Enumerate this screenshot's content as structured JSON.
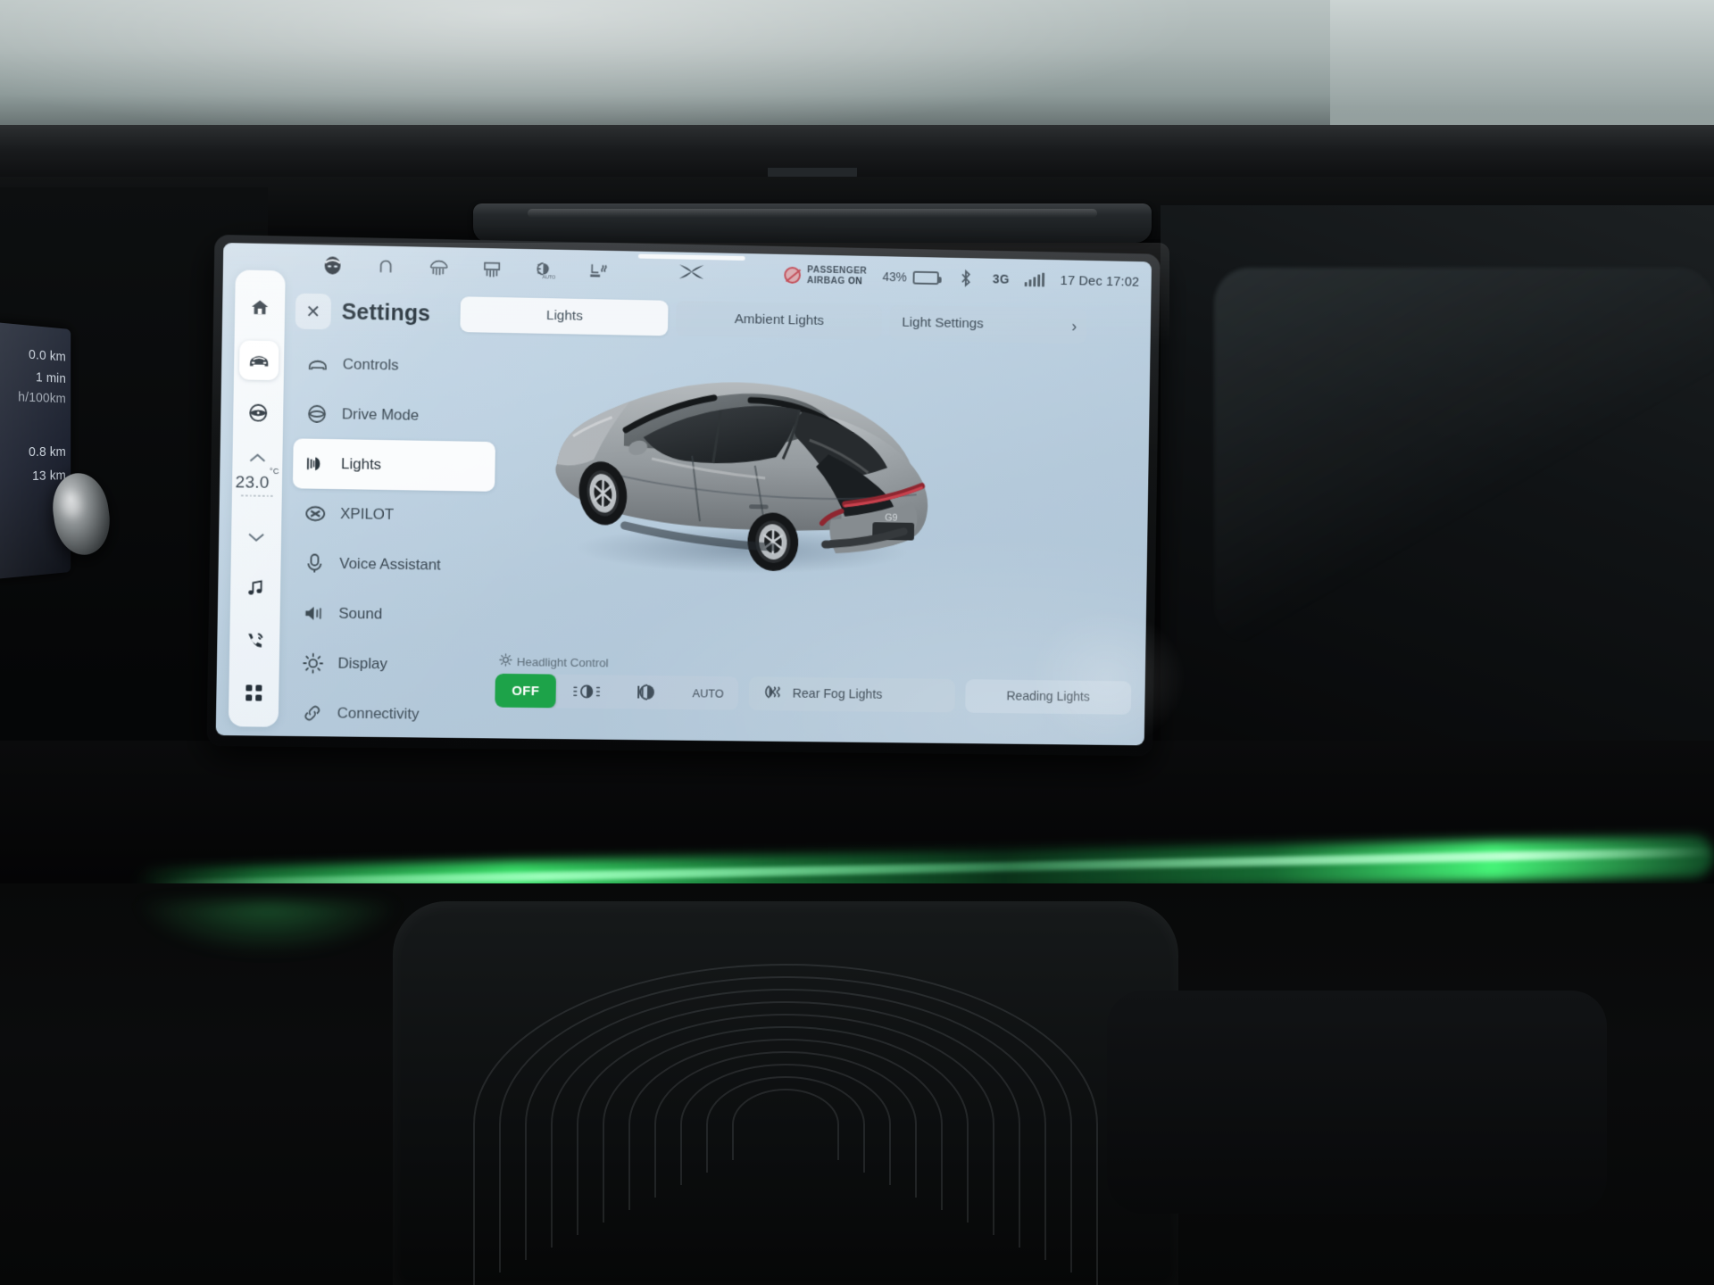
{
  "cluster": {
    "rows": [
      "0.0 km",
      "1 min",
      "h/100km",
      "0.8 km",
      "13 km"
    ]
  },
  "statusbar": {
    "icons": [
      "profile-avatar-icon",
      "headrest-icon",
      "rear-defrost-icon",
      "front-defrost-icon",
      "auto-headlight-icon",
      "seat-heating-icon"
    ],
    "brand_logo": "xpeng-x-logo",
    "airbag_line1": "PASSENGER",
    "airbag_line2_prefix": "AIRBAG",
    "airbag_state": "ON",
    "battery_percent": "43%",
    "bluetooth": "bluetooth-icon",
    "network": "3G",
    "clock": "17 Dec 17:02"
  },
  "rail": {
    "items": [
      {
        "name": "home-icon",
        "label": "Home"
      },
      {
        "name": "car-icon",
        "label": "Vehicle"
      },
      {
        "name": "steering-wheel-icon",
        "label": "Driving"
      }
    ],
    "temp_up": "chevron-up-icon",
    "temperature": "23.0",
    "temperature_unit": "°C",
    "temp_down": "chevron-down-icon",
    "bottom_items": [
      {
        "name": "music-note-icon",
        "label": "Media"
      },
      {
        "name": "phone-icon",
        "label": "Phone"
      },
      {
        "name": "apps-grid-icon",
        "label": "Apps"
      }
    ]
  },
  "page": {
    "close_label": "✕",
    "title": "Settings"
  },
  "tabs": [
    {
      "label": "Lights",
      "active": true
    },
    {
      "label": "Ambient Lights",
      "active": false
    },
    {
      "label": "Light Settings",
      "active": false,
      "chevron": "›"
    }
  ],
  "menu": [
    {
      "label": "Controls",
      "icon": "car-front-icon",
      "active": false
    },
    {
      "label": "Drive Mode",
      "icon": "drive-mode-icon",
      "active": false
    },
    {
      "label": "Lights",
      "icon": "headlight-icon",
      "active": true
    },
    {
      "label": "XPILOT",
      "icon": "xpilot-icon",
      "active": false
    },
    {
      "label": "Voice Assistant",
      "icon": "microphone-icon",
      "active": false
    },
    {
      "label": "Sound",
      "icon": "speaker-icon",
      "active": false
    },
    {
      "label": "Display",
      "icon": "brightness-icon",
      "active": false
    },
    {
      "label": "Connectivity",
      "icon": "connectivity-icon",
      "active": false
    }
  ],
  "vehicle": {
    "model_badge": "G9",
    "body_color": "#9aa0a4",
    "view": "rear-three-quarter"
  },
  "headlight_control": {
    "label": "Headlight Control",
    "label_icon": "sun-headlight-icon",
    "segments": [
      {
        "label": "OFF",
        "active": true,
        "type": "text"
      },
      {
        "label": "",
        "active": false,
        "type": "position-light-icon"
      },
      {
        "label": "",
        "active": false,
        "type": "low-beam-icon"
      },
      {
        "label": "AUTO",
        "active": false,
        "type": "text"
      }
    ]
  },
  "buttons": [
    {
      "label": "Rear Fog Lights",
      "icon": "rear-fog-light-icon"
    },
    {
      "label": "Reading Lights",
      "icon": ""
    }
  ],
  "colors": {
    "accent_green": "#1da349",
    "screen_bg": "#b8cddc",
    "text_primary": "#1b2832",
    "ambient_strip": "#3ceb6e"
  }
}
